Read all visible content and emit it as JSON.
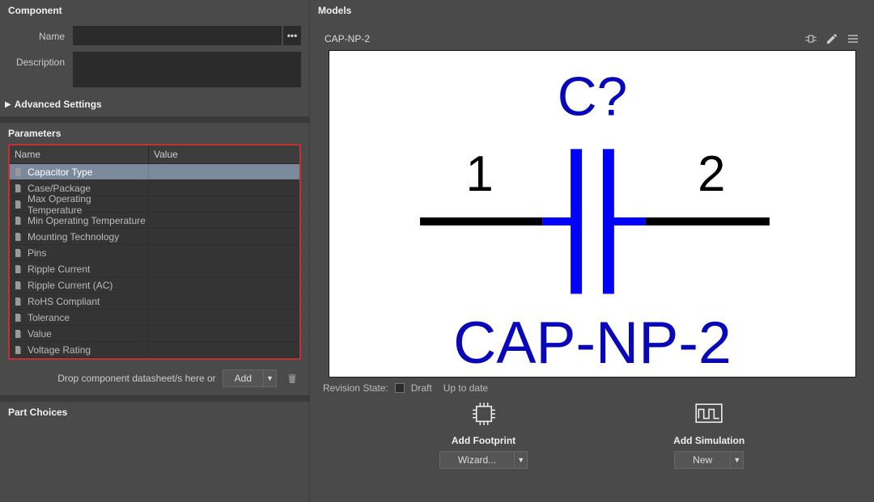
{
  "component": {
    "panel_title": "Component",
    "name_label": "Name",
    "name_value": "",
    "ellipsis": "•••",
    "desc_label": "Description",
    "desc_value": "",
    "advanced_label": "Advanced Settings"
  },
  "parameters": {
    "panel_title": "Parameters",
    "col_name": "Name",
    "col_value": "Value",
    "rows": [
      {
        "name": "Capacitor Type",
        "value": "",
        "selected": true
      },
      {
        "name": "Case/Package",
        "value": ""
      },
      {
        "name": "Max Operating Temperature",
        "value": ""
      },
      {
        "name": "Min Operating Temperature",
        "value": ""
      },
      {
        "name": "Mounting Technology",
        "value": ""
      },
      {
        "name": "Pins",
        "value": ""
      },
      {
        "name": "Ripple Current",
        "value": ""
      },
      {
        "name": "Ripple Current (AC)",
        "value": ""
      },
      {
        "name": "RoHS Compliant",
        "value": ""
      },
      {
        "name": "Tolerance",
        "value": ""
      },
      {
        "name": "Value",
        "value": ""
      },
      {
        "name": "Voltage Rating",
        "value": ""
      }
    ],
    "drop_text": "Drop component datasheet/s here or",
    "add_button": "Add"
  },
  "part_choices": {
    "panel_title": "Part Choices"
  },
  "models": {
    "panel_title": "Models",
    "current_model": "CAP-NP-2",
    "symbol": {
      "designator": "C?",
      "pin1": "1",
      "pin2": "2",
      "name": "CAP-NP-2"
    },
    "revision_label": "Revision State:",
    "draft_label": "Draft",
    "uptodate_label": "Up to date",
    "footprint": {
      "title": "Add Footprint",
      "button": "Wizard..."
    },
    "simulation": {
      "title": "Add Simulation",
      "button": "New"
    }
  }
}
